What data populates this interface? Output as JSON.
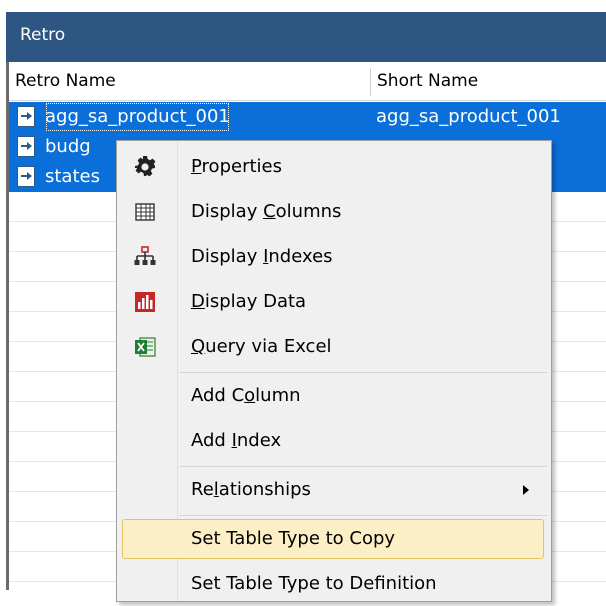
{
  "window": {
    "title": "Retro"
  },
  "grid": {
    "columns": [
      "Retro Name",
      "Short Name"
    ],
    "rows": [
      {
        "name": "agg_sa_product_001",
        "short": "agg_sa_product_001"
      },
      {
        "name": "budg",
        "short": ""
      },
      {
        "name": "states",
        "short": ""
      }
    ]
  },
  "menu": {
    "items": [
      {
        "pre": "",
        "key": "P",
        "post": "roperties",
        "icon": "gear-icon"
      },
      {
        "pre": "Display ",
        "key": "C",
        "post": "olumns",
        "icon": "table-grid-icon"
      },
      {
        "pre": "Display ",
        "key": "I",
        "post": "ndexes",
        "icon": "hierarchy-icon"
      },
      {
        "pre": "",
        "key": "D",
        "post": "isplay Data",
        "icon": "bar-chart-icon"
      },
      {
        "pre": "",
        "key": "Q",
        "post": "uery via Excel",
        "icon": "excel-icon"
      },
      {
        "pre": "Add C",
        "key": "o",
        "post": "lumn"
      },
      {
        "pre": "Add ",
        "key": "I",
        "post": "ndex"
      },
      {
        "pre": "Re",
        "key": "l",
        "post": "ationships",
        "submenu": true
      },
      {
        "pre": "Set Table Type to Copy",
        "key": "",
        "post": ""
      },
      {
        "pre": "Set Table Type to Definition",
        "key": "",
        "post": ""
      }
    ]
  },
  "colors": {
    "title_bar": "#2d5782",
    "selection": "#0a6fd8",
    "menu_highlight": "#fcefc6"
  }
}
